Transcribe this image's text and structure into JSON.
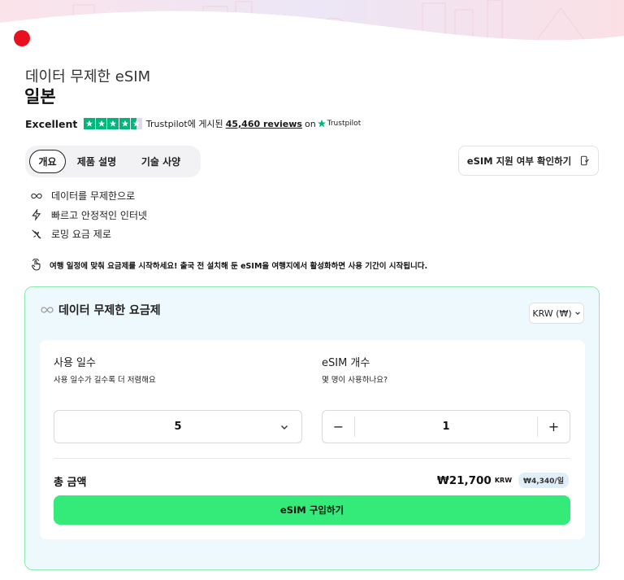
{
  "header": {
    "subtitle": "데이터 무제한 eSIM",
    "title": "일본"
  },
  "trustpilot": {
    "rating_word": "Excellent",
    "rating_stars": 4.5,
    "posted_on": "Trustpilot에 게시된",
    "reviews": "45,460 reviews",
    "on": "on",
    "brand": "Trustpilot"
  },
  "tabs": [
    {
      "label": "개요",
      "active": true
    },
    {
      "label": "제품 설명",
      "active": false
    },
    {
      "label": "기술 사양",
      "active": false
    }
  ],
  "compat_button": "eSIM 지원 여부 확인하기",
  "features": [
    {
      "icon": "infinity-icon",
      "label": "데이터를 무제한으로"
    },
    {
      "icon": "lightning-icon",
      "label": "빠르고 안정적인 인터넷"
    },
    {
      "icon": "no-roaming-icon",
      "label": "로밍 요금 제로"
    }
  ],
  "notice": "여행 일정에 맞춰 요금제를 시작하세요! 출국 전 설치해 둔 eSIM을 여행지에서 활성화하면 사용 기간이 시작됩니다.",
  "plan": {
    "title": "데이터 무제한 요금제",
    "currency": "KRW (₩)",
    "days_label": "사용 일수",
    "days_hint": "사용 일수가 길수록 더 저렴해요",
    "days_value": "5",
    "esim_label": "eSIM 개수",
    "esim_hint": "몇 명이 사용하나요?",
    "esim_value": "1",
    "minus": "−",
    "plus": "+",
    "total_label": "총 금액",
    "total_price": "₩21,700",
    "total_currency": "KRW",
    "per_day": "₩4,340/일",
    "buy_button": "eSIM 구입하기"
  },
  "colors": {
    "accent_green": "#34ea78",
    "trustpilot_green": "#00b67a",
    "card_border": "#8ee8ad",
    "card_bg": "#eef9fd",
    "flag_red": "#e8101e"
  }
}
